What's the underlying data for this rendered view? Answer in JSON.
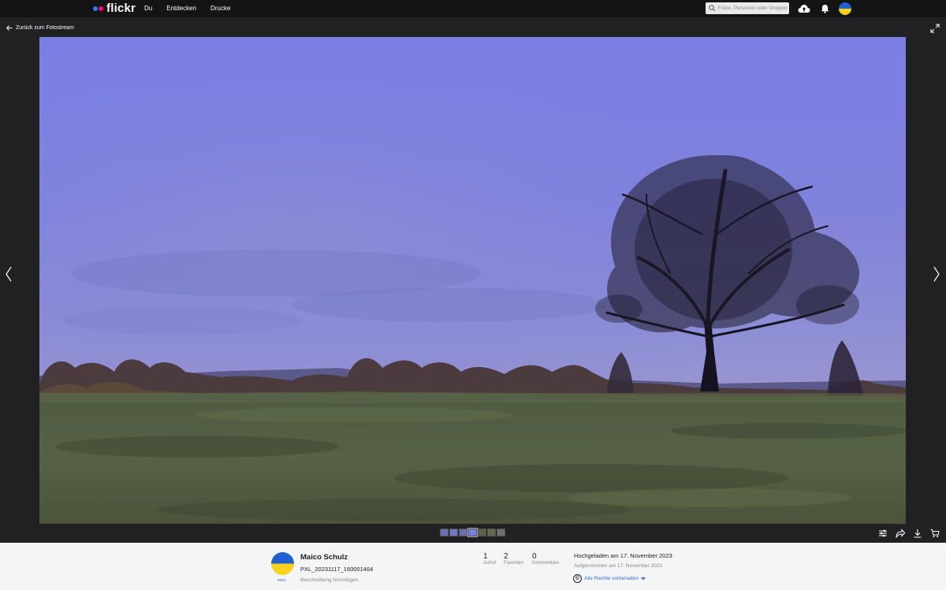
{
  "nav": {
    "logo_text": "flickr",
    "logo_colors": [
      "#2f7bff",
      "#ff0084"
    ],
    "links": [
      "Du",
      "Entdecken",
      "Drucke"
    ],
    "search_placeholder": "Fotos, Personen oder Gruppen",
    "icons": [
      "upload-cloud-icon",
      "bell-icon",
      "user-avatar"
    ]
  },
  "viewer": {
    "back_label": "Zurück zum Fotostream",
    "thumb_count": 7,
    "active_thumb": 3,
    "tools": [
      "adjust-icon",
      "share-icon",
      "download-icon",
      "cart-icon"
    ]
  },
  "info": {
    "author": "Maico Schulz",
    "pro_badge": "PRO",
    "title": "PXL_20231117_160001464",
    "description_link": "Beschreibung hinzufügen",
    "stats": [
      {
        "value": "1",
        "label": "Aufruf"
      },
      {
        "value": "2",
        "label": "Favoriten"
      },
      {
        "value": "0",
        "label": "Kommentare"
      }
    ],
    "uploaded": "Hochgeladen am 17. November 2023",
    "taken": "Aufgenommen am 17. November 2023",
    "rights": "Alle Rechte vorbehalten"
  },
  "colors": {
    "ukraine_blue": "#1f5fcf",
    "ukraine_yellow": "#f7d21e",
    "link_blue": "#3a6fc4"
  }
}
